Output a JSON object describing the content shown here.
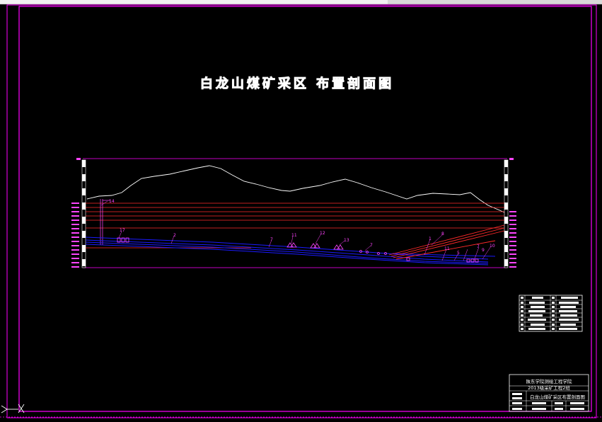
{
  "drawing": {
    "title": "白龙山煤矿采区 布置剖面图",
    "colors": {
      "frame": "#ff00ff",
      "terrain": "#ffffff",
      "strata": "#ff2a2a",
      "seam": "#1a1aff",
      "label": "#ff44ff"
    }
  },
  "profile": {
    "callouts": [
      "14",
      "17",
      "2",
      "7",
      "11",
      "12",
      "13",
      "7",
      "1",
      "8",
      "11",
      "5",
      "7",
      "9",
      "10"
    ]
  },
  "title_block": {
    "school": "陕东学院测绘工程学院",
    "class": "2013级采矿工程2班",
    "drawing_name": "白龙山煤矿采区布置剖面图"
  },
  "icons": {
    "ucs": "ucs-axis-icon"
  }
}
